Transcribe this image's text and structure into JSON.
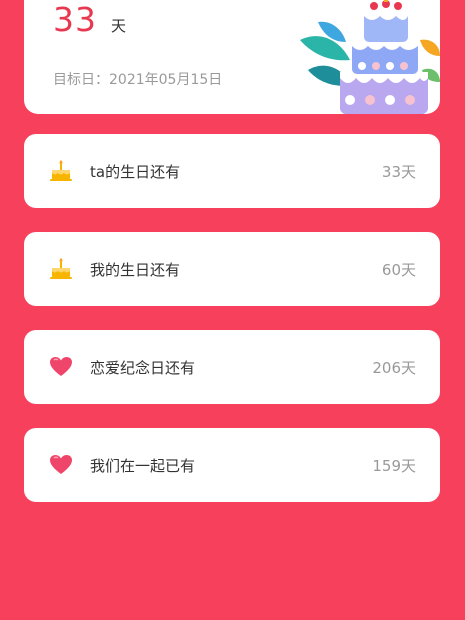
{
  "top": {
    "days_number": "33",
    "days_unit": "天",
    "target_label": "目标日：",
    "target_date": "2021年05月15日"
  },
  "items": [
    {
      "label": "ta的生日还有",
      "value": "33天",
      "icon": "cake-icon"
    },
    {
      "label": "我的生日还有",
      "value": "60天",
      "icon": "cake-icon"
    },
    {
      "label": "恋爱纪念日还有",
      "value": "206天",
      "icon": "heart-icon"
    },
    {
      "label": "我们在一起已有",
      "value": "159天",
      "icon": "heart-icon"
    }
  ],
  "colors": {
    "background": "#f7405c",
    "accent": "#e8384f",
    "cake": "#f7b500",
    "heart": "#f0456a"
  }
}
